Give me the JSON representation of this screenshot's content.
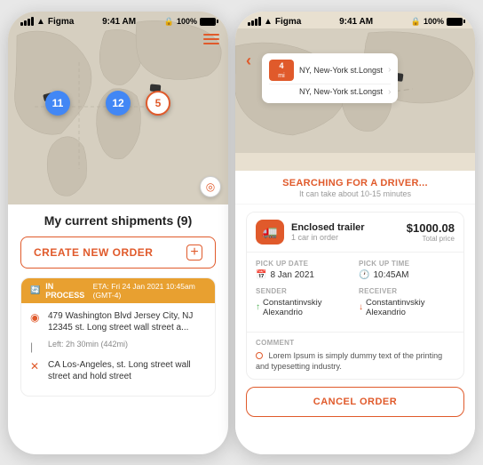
{
  "left_phone": {
    "status_bar": {
      "app": "Figma",
      "time": "9:41 AM",
      "battery": "100%"
    },
    "shipments_title": "My current shipments (9)",
    "create_order_label": "CREATE NEW ORDER",
    "shipment_card": {
      "status_label": "IN PROCESS",
      "eta_label": "ETA: Fri 24 Jan 2021 10:45am (GMT-4)",
      "address": "479 Washington Blvd Jersey City, NJ 12345 st. Long street wall street a...",
      "time_left": "Left: 2h 30min (442mi)",
      "destination": "CA Los-Angeles, st. Long street wall street and hold street"
    },
    "map_markers": [
      {
        "label": "11",
        "type": "blue"
      },
      {
        "label": "12",
        "type": "blue"
      },
      {
        "label": "5",
        "type": "orange"
      }
    ]
  },
  "right_phone": {
    "status_bar": {
      "app": "Figma",
      "time": "9:41 AM",
      "battery": "100%"
    },
    "route": {
      "distance": "4",
      "unit": "mi",
      "from": "NY, New-York st.Longst",
      "to": "NY, New-York st.Longst"
    },
    "searching_title": "SEARCHING FOR A DRIVER...",
    "searching_sub": "It can take about 10-15 minutes",
    "order": {
      "name": "Enclosed trailer",
      "sub_label": "1 car in order",
      "price": "$1000.08",
      "price_label": "Total price",
      "pickup_date_label": "PICK UP DATE",
      "pickup_date": "8 Jan 2021",
      "pickup_time_label": "PICK UP TIME",
      "pickup_time": "10:45AM",
      "sender_label": "SENDER",
      "sender_name": "Constantinvskiy Alexandrio",
      "receiver_label": "RECEIVER",
      "receiver_name": "Constantinvskiy Alexandrio",
      "comment_label": "COMMENT",
      "comment_text": "Lorem Ipsum is simply dummy text of the printing and typesetting industry.",
      "cancel_label": "CANCEL ORDER"
    }
  }
}
